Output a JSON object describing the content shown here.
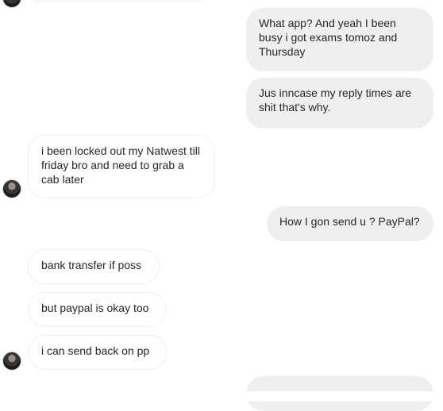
{
  "messages": {
    "out_1": "What app? And yeah I been busy i got exams tomoz and Thursday",
    "out_2": "Jus inncase my reply times are shit that's why.",
    "in_1": "i been locked out my Natwest till friday bro and need to grab a cab later",
    "out_3": "How I gon send u ? PayPal?",
    "in_2": "bank transfer if poss",
    "in_3": "but paypal is okay too",
    "in_4": "i can send back on pp",
    "out_4": ""
  },
  "colors": {
    "outgoing_bubble": "#efefef",
    "incoming_border": "#efefef",
    "text": "#262626"
  }
}
